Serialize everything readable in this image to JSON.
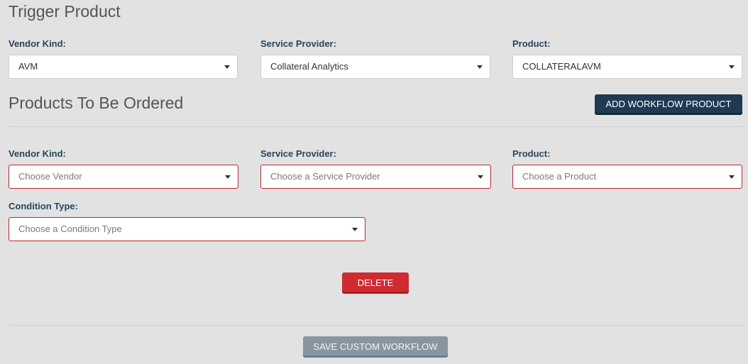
{
  "trigger": {
    "title": "Trigger Product",
    "vendor_kind": {
      "label": "Vendor Kind:",
      "value": "AVM"
    },
    "service_provider": {
      "label": "Service Provider:",
      "value": "Collateral Analytics"
    },
    "product": {
      "label": "Product:",
      "value": "COLLATERALAVM"
    }
  },
  "ordered": {
    "title": "Products To Be Ordered",
    "add_button": "ADD WORKFLOW PRODUCT",
    "vendor_kind": {
      "label": "Vendor Kind:",
      "placeholder": "Choose Vendor"
    },
    "service_provider": {
      "label": "Service Provider:",
      "placeholder": "Choose a Service Provider"
    },
    "product": {
      "label": "Product:",
      "placeholder": "Choose a Product"
    },
    "condition_type": {
      "label": "Condition Type:",
      "placeholder": "Choose a Condition Type"
    },
    "delete_button": "DELETE"
  },
  "footer": {
    "save_button": "SAVE CUSTOM WORKFLOW"
  },
  "colors": {
    "background": "#e2e2e2",
    "label": "#27455c",
    "primary_dark": "#1f3a52",
    "danger": "#cf2b31",
    "disabled": "#8796a1",
    "invalid_border": "#b52a2e"
  },
  "icons": [
    "dropdown-caret-icon"
  ]
}
